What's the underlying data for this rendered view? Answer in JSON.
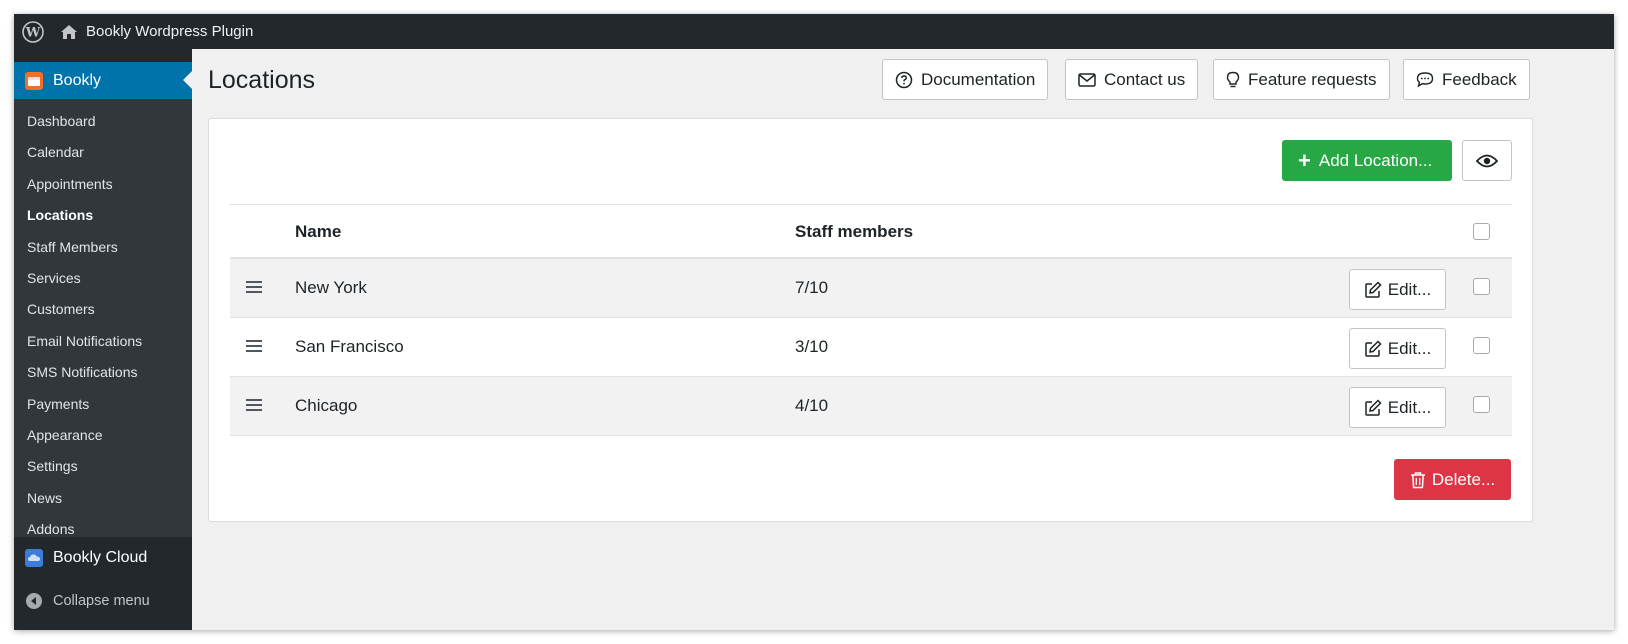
{
  "adminbar": {
    "site_name": "Bookly Wordpress Plugin"
  },
  "sidebar": {
    "top_item": "Bookly",
    "items": [
      {
        "label": "Dashboard"
      },
      {
        "label": "Calendar"
      },
      {
        "label": "Appointments"
      },
      {
        "label": "Locations",
        "current": true
      },
      {
        "label": "Staff Members"
      },
      {
        "label": "Services"
      },
      {
        "label": "Customers"
      },
      {
        "label": "Email Notifications"
      },
      {
        "label": "SMS Notifications"
      },
      {
        "label": "Payments"
      },
      {
        "label": "Appearance"
      },
      {
        "label": "Settings"
      },
      {
        "label": "News"
      },
      {
        "label": "Addons"
      }
    ],
    "cloud": "Bookly Cloud",
    "collapse": "Collapse menu"
  },
  "header": {
    "title": "Locations",
    "buttons": {
      "documentation": "Documentation",
      "contact": "Contact us",
      "feature": "Feature requests",
      "feedback": "Feedback"
    }
  },
  "toolbar": {
    "add_label": "Add Location..."
  },
  "table": {
    "columns": {
      "name": "Name",
      "staff": "Staff members"
    },
    "rows": [
      {
        "name": "New York",
        "staff": "7/10",
        "edit": "Edit..."
      },
      {
        "name": "San Francisco",
        "staff": "3/10",
        "edit": "Edit..."
      },
      {
        "name": "Chicago",
        "staff": "4/10",
        "edit": "Edit..."
      }
    ]
  },
  "footer": {
    "delete_label": "Delete..."
  },
  "colors": {
    "primary_menu": "#0073aa",
    "add": "#28a745",
    "delete": "#dc3545",
    "sidebar": "#23282d"
  }
}
